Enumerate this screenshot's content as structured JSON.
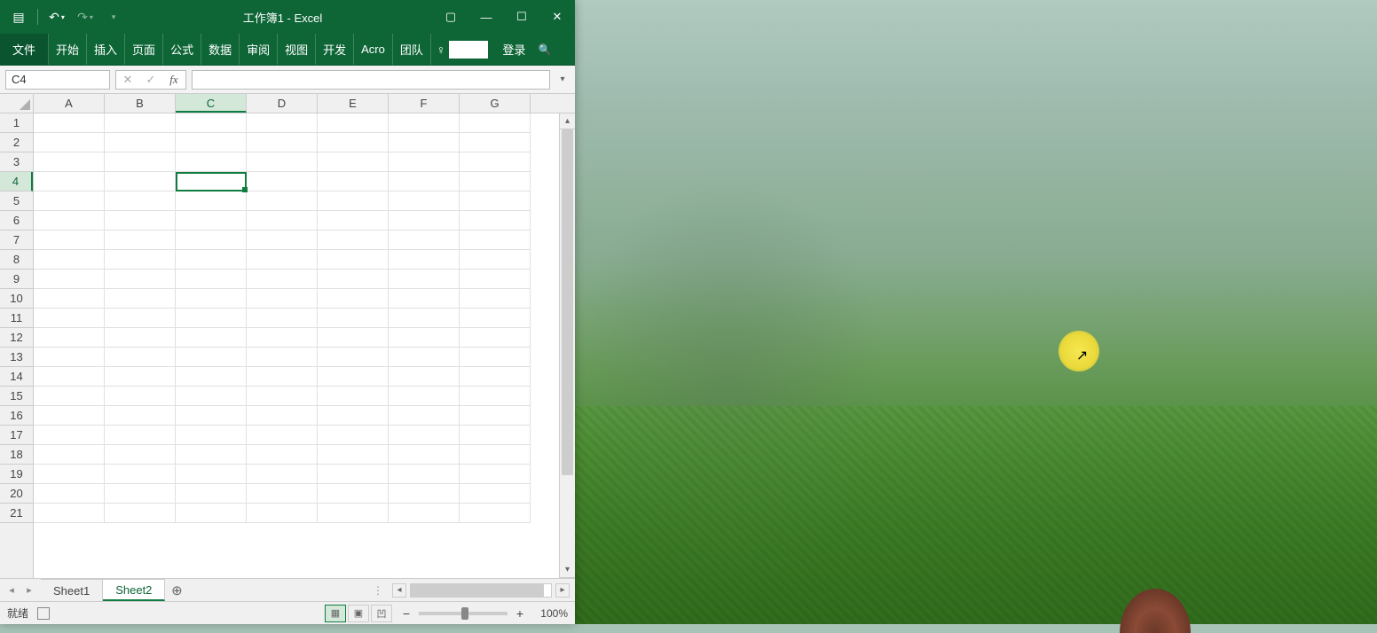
{
  "title": "工作簿1 - Excel",
  "qat": {
    "save": "💾",
    "undo": "↶",
    "redo": "↷"
  },
  "ribbon": {
    "file": "文件",
    "tabs": [
      "开始",
      "插入",
      "页面",
      "公式",
      "数据",
      "审阅",
      "视图",
      "开发",
      "Acro",
      "团队"
    ],
    "signin": "登录"
  },
  "namebox": {
    "value": "C4"
  },
  "formula": {
    "value": ""
  },
  "columns": [
    "A",
    "B",
    "C",
    "D",
    "E",
    "F",
    "G"
  ],
  "rows": [
    "1",
    "2",
    "3",
    "4",
    "5",
    "6",
    "7",
    "8",
    "9",
    "10",
    "11",
    "12",
    "13",
    "14",
    "15",
    "16",
    "17",
    "18",
    "19",
    "20",
    "21"
  ],
  "selected": {
    "col": "C",
    "row": "4"
  },
  "sheets": {
    "items": [
      "Sheet1",
      "Sheet2"
    ],
    "active": "Sheet2"
  },
  "status": {
    "ready": "就绪",
    "zoom": "100%"
  }
}
